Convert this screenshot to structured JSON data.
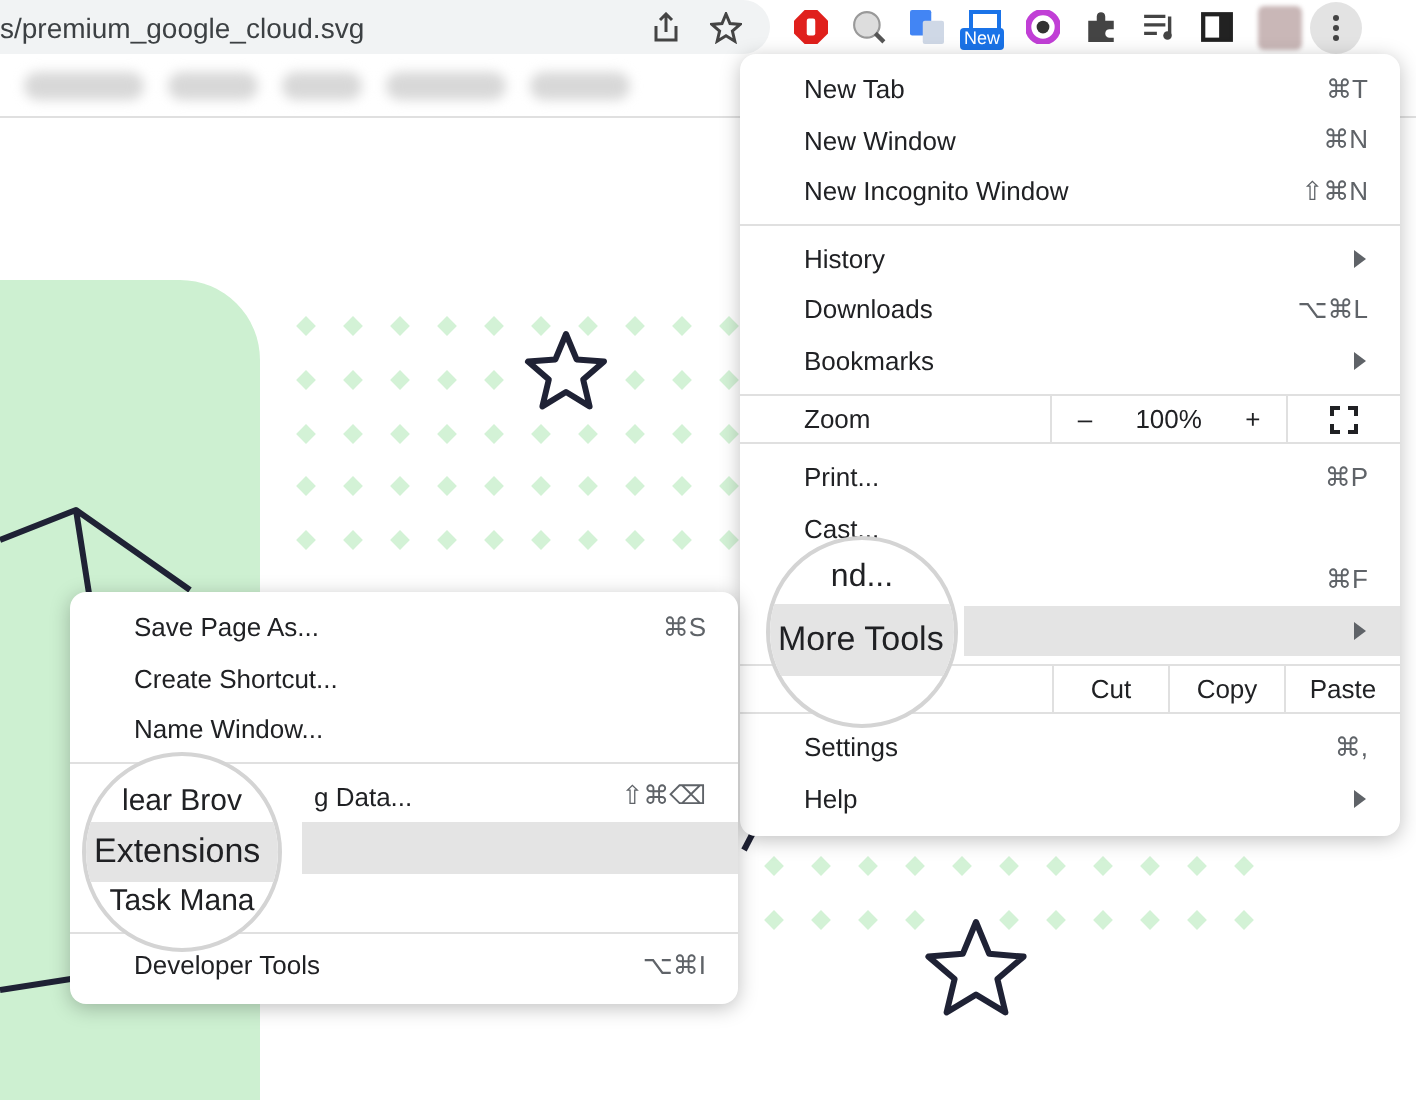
{
  "toolbar": {
    "url": "s/premium_google_cloud.svg",
    "extension_badge": "New"
  },
  "main_menu": {
    "items": [
      {
        "kind": "item",
        "label": "New Tab",
        "shortcut": "⌘T",
        "selected": false
      },
      {
        "kind": "item",
        "label": "New Window",
        "shortcut": "⌘N",
        "selected": false
      },
      {
        "kind": "item",
        "label": "New Incognito Window",
        "shortcut": "⇧⌘N",
        "selected": false
      },
      {
        "kind": "divider"
      },
      {
        "kind": "item",
        "label": "History",
        "submenu": true,
        "selected": false
      },
      {
        "kind": "item",
        "label": "Downloads",
        "shortcut": "⌥⌘L",
        "selected": false
      },
      {
        "kind": "item",
        "label": "Bookmarks",
        "submenu": true,
        "selected": false
      },
      {
        "kind": "zoom",
        "label": "Zoom",
        "minus": "–",
        "value": "100%",
        "plus": "+"
      },
      {
        "kind": "item",
        "label": "Print...",
        "shortcut": "⌘P",
        "selected": false
      },
      {
        "kind": "item",
        "label": "Cast...",
        "selected": false
      },
      {
        "kind": "item",
        "shortcut": "⌘F",
        "selected": false
      },
      {
        "kind": "item",
        "submenu": true,
        "selected": true
      },
      {
        "kind": "edit",
        "buttons": [
          "Cut",
          "Copy",
          "Paste"
        ]
      },
      {
        "kind": "item",
        "label": "Settings",
        "shortcut": "⌘,",
        "selected": false
      },
      {
        "kind": "item",
        "label": "Help",
        "submenu": true,
        "selected": false
      }
    ],
    "magnifier": [
      {
        "kind": "fragment",
        "text": "nd..."
      },
      {
        "kind": "focus",
        "text": "More Tools"
      }
    ]
  },
  "sub_menu": {
    "items": [
      {
        "kind": "item",
        "label": "Save Page As...",
        "shortcut": "⌘S",
        "selected": false
      },
      {
        "kind": "item",
        "label": "Create Shortcut...",
        "selected": false
      },
      {
        "kind": "item",
        "label": "Name Window...",
        "selected": false
      },
      {
        "kind": "divider"
      },
      {
        "kind": "item",
        "label": "g Data...",
        "partial": true,
        "shortcut": "⇧⌘⌫",
        "selected": false
      },
      {
        "kind": "item",
        "selected": true
      },
      {
        "kind": "item",
        "selected": false
      },
      {
        "kind": "divider"
      },
      {
        "kind": "item",
        "label": "Developer Tools",
        "shortcut": "⌥⌘I",
        "selected": false
      }
    ],
    "magnifier": [
      {
        "kind": "fragment",
        "text": "lear Brov"
      },
      {
        "kind": "focus",
        "text": "Extensions"
      },
      {
        "kind": "fragment",
        "text": "Task Mana"
      }
    ]
  }
}
